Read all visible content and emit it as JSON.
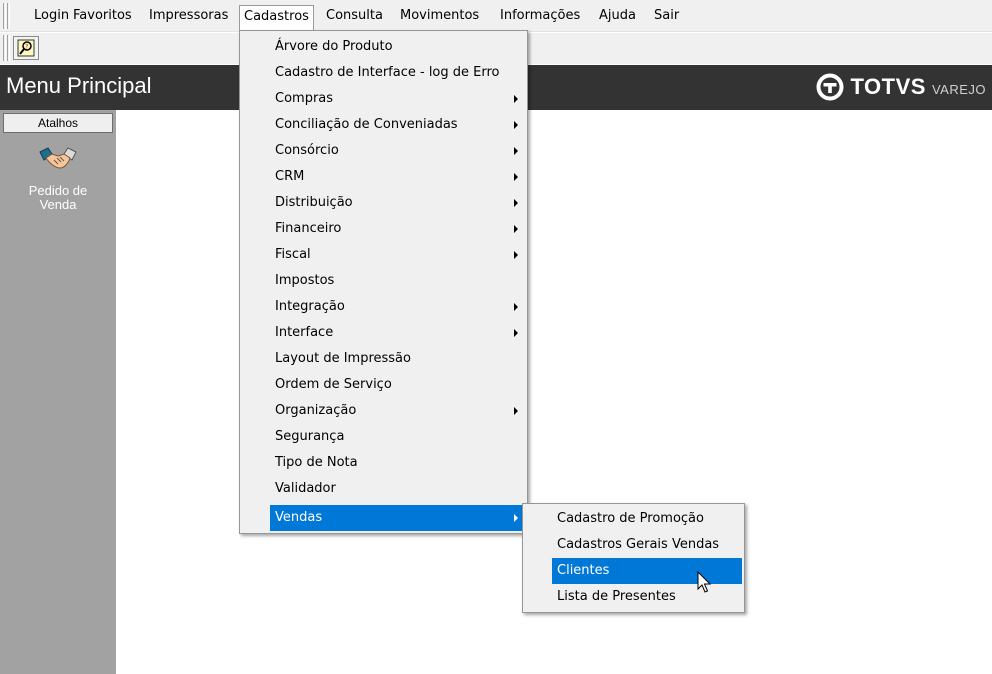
{
  "menubar": {
    "items": [
      {
        "label": "Login",
        "mnemonic": "L"
      },
      {
        "label": "Favoritos",
        "mnemonic": "F"
      },
      {
        "label": "Impressoras",
        "mnemonic": "I"
      },
      {
        "label": "Cadastros",
        "mnemonic": "C",
        "active": true
      },
      {
        "label": "Consulta",
        "mnemonic": "o"
      },
      {
        "label": "Movimentos",
        "mnemonic": "M"
      },
      {
        "label": "Informações",
        "mnemonic": "n"
      },
      {
        "label": "Ajuda",
        "mnemonic": "A"
      },
      {
        "label": "Sair",
        "mnemonic": "S"
      }
    ]
  },
  "toolbar": {
    "button_icon": "help-search-icon"
  },
  "header": {
    "title": "Menu Principal",
    "brand_name": "TOTVS",
    "brand_sub": "VAREJO",
    "background": "#333333"
  },
  "sidebar": {
    "tab_label": "Atalhos",
    "shortcut": {
      "icon": "handshake-icon",
      "label": "Pedido de Venda"
    },
    "background": "#a2a2a2"
  },
  "dropdown": {
    "items": [
      {
        "label": "Árvore do Produto",
        "submenu": false
      },
      {
        "label": "Cadastro de Interface - log de Erro",
        "submenu": false
      },
      {
        "label": "Compras",
        "submenu": true
      },
      {
        "label": "Conciliação de Conveniadas",
        "submenu": true
      },
      {
        "label": "Consórcio",
        "submenu": true
      },
      {
        "label": "CRM",
        "submenu": true
      },
      {
        "label": "Distribuição",
        "submenu": true
      },
      {
        "label": "Financeiro",
        "submenu": true
      },
      {
        "label": "Fiscal",
        "submenu": true
      },
      {
        "label": "Impostos",
        "submenu": false
      },
      {
        "label": "Integração",
        "submenu": true
      },
      {
        "label": "Interface",
        "submenu": true
      },
      {
        "label": "Layout de Impressão",
        "submenu": false
      },
      {
        "label": "Ordem de Serviço",
        "submenu": false
      },
      {
        "label": "Organização",
        "submenu": true
      },
      {
        "label": "Segurança",
        "submenu": false
      },
      {
        "label": "Tipo de Nota",
        "submenu": false
      },
      {
        "label": "Validador",
        "submenu": false
      },
      {
        "label": "Vendas",
        "submenu": true,
        "highlighted": true
      }
    ]
  },
  "submenu": {
    "items": [
      {
        "label": "Cadastro de Promoção"
      },
      {
        "label": "Cadastros Gerais Vendas"
      },
      {
        "label": "Clientes",
        "highlighted": true
      },
      {
        "label": "Lista de Presentes"
      }
    ]
  },
  "colors": {
    "highlight": "#0078d7",
    "menu_bg": "#f0f0f0"
  }
}
